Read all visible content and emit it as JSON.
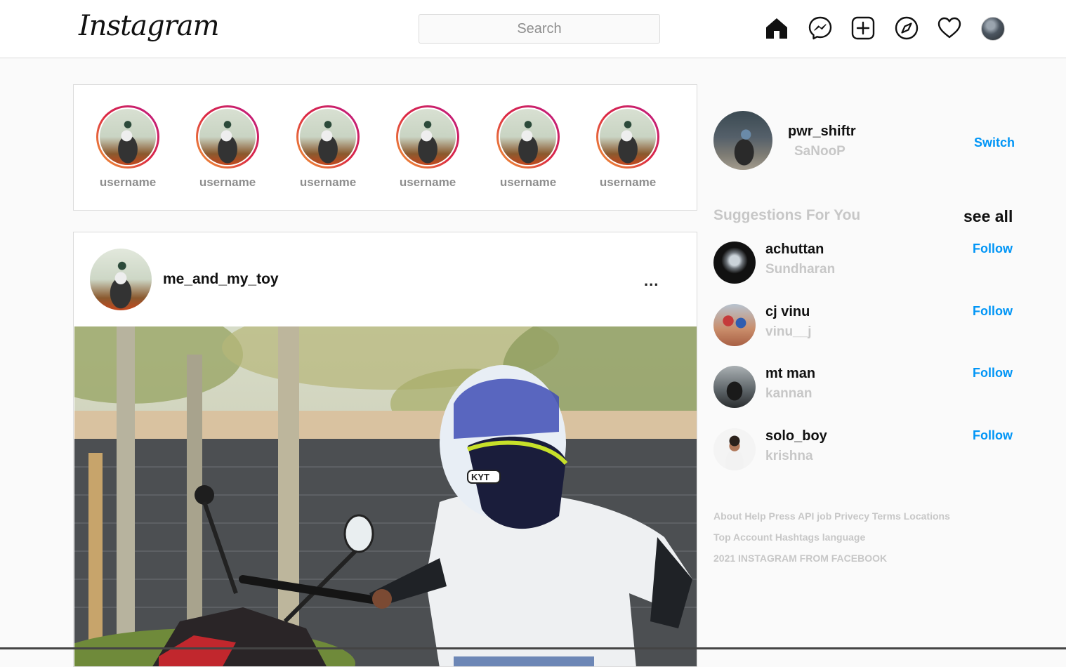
{
  "header": {
    "logo": "Instagram",
    "search_placeholder": "Search",
    "nav_icons": [
      "home-icon",
      "messenger-icon",
      "new-post-icon",
      "explore-icon",
      "activity-heart-icon",
      "profile-avatar"
    ]
  },
  "stories": [
    {
      "label": "username"
    },
    {
      "label": "username"
    },
    {
      "label": "username"
    },
    {
      "label": "username"
    },
    {
      "label": "username"
    },
    {
      "label": "username"
    }
  ],
  "post": {
    "username": "me_and_my_toy",
    "more": "..."
  },
  "profile": {
    "username": "pwr_shiftr",
    "name": "SaNooP",
    "switch_label": "Switch"
  },
  "suggestions": {
    "title": "Suggestions For You",
    "see_all": "see all",
    "items": [
      {
        "username": "achuttan",
        "name": "Sundharan",
        "action": "Follow"
      },
      {
        "username": "cj vinu",
        "name": "vinu__j",
        "action": "Follow"
      },
      {
        "username": "mt man",
        "name": "kannan",
        "action": "Follow"
      },
      {
        "username": "solo_boy",
        "name": "krishna",
        "action": "Follow"
      }
    ]
  },
  "footer": {
    "line1": "About Help Press API job Privecy Terms Locations",
    "line2": "Top Account Hashtags language",
    "line3": "2021 INSTAGRAM FROM FACEBOOK"
  },
  "colors": {
    "accent": "#0095f6",
    "muted": "#c7c7c7",
    "border": "#dbdbdb"
  }
}
